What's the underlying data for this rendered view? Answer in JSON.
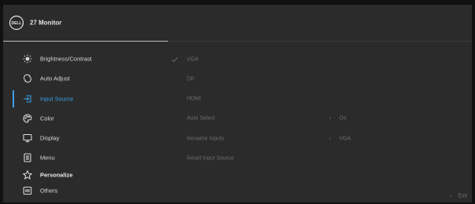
{
  "header": {
    "brand_logo_text": "DELL",
    "title": "27 Monitor"
  },
  "menu": [
    {
      "id": "brightness-contrast",
      "label": "Brightness/Contrast",
      "icon": "brightness-icon"
    },
    {
      "id": "auto-adjust",
      "label": "Auto Adjust",
      "icon": "auto-adjust-icon"
    },
    {
      "id": "input-source",
      "label": "Input Source",
      "icon": "input-source-icon",
      "active": true
    },
    {
      "id": "color",
      "label": "Color",
      "icon": "palette-icon"
    },
    {
      "id": "display",
      "label": "Display",
      "icon": "display-icon"
    },
    {
      "id": "menu",
      "label": "Menu",
      "icon": "menu-icon"
    },
    {
      "id": "personalize",
      "label": "Personalize",
      "icon": "star-icon"
    },
    {
      "id": "others",
      "label": "Others",
      "icon": "others-icon"
    }
  ],
  "submenu": {
    "vga": {
      "label": "VGA",
      "checked": true
    },
    "dp": {
      "label": "DP"
    },
    "hdmi": {
      "label": "HDMI"
    },
    "auto_select": {
      "label": "Auto Select",
      "value": "On"
    },
    "rename_inputs": {
      "label": "Rename Inputs",
      "value": "VGA"
    },
    "reset": {
      "label": "Reset Input Source"
    }
  },
  "footer": {
    "exit_label": "Exit"
  },
  "colors": {
    "accent": "#3aa0e8",
    "panel": "#2b2b2b",
    "text": "#d9d9d9",
    "dim": "#6d6d6d"
  }
}
